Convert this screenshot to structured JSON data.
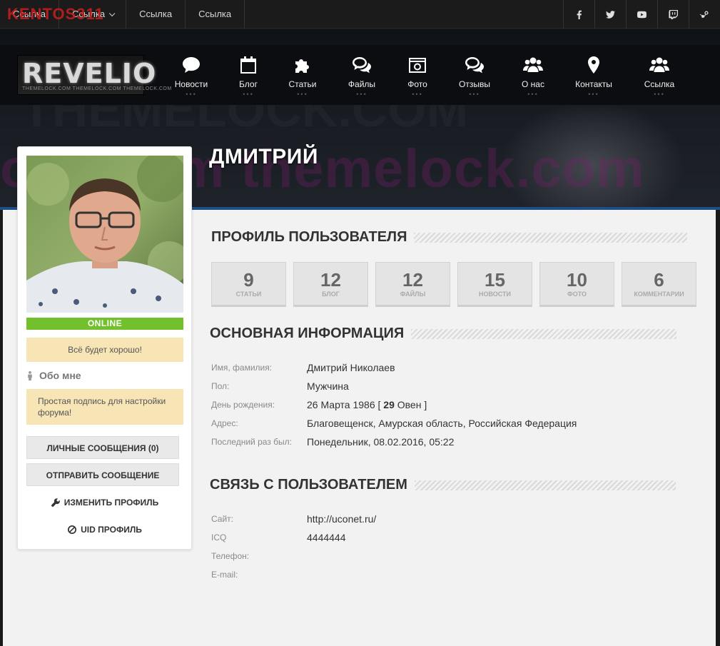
{
  "topbar": {
    "links": [
      {
        "label": "Ссылка",
        "has_caret": false
      },
      {
        "label": "Ссылка",
        "has_caret": true
      },
      {
        "label": "Ссылка",
        "has_caret": false
      },
      {
        "label": "Ссылка",
        "has_caret": false
      }
    ],
    "watermark": "KENTOS311",
    "socials": [
      "facebook-icon",
      "twitter-icon",
      "youtube-icon",
      "twitch-icon",
      "steam-icon"
    ]
  },
  "header": {
    "logo": "REVELIO",
    "logo_sub": "THEMELOCK.COM THEMELOCK.COM THEMELOCK.COM",
    "bg_text": "ock.com themelock.com",
    "bg_text2": "THEMELOCK.COM",
    "profile_name": "ДМИТРИЙ"
  },
  "nav": [
    {
      "label": "Новости",
      "icon": "comment-icon"
    },
    {
      "label": "Блог",
      "icon": "calendar-icon"
    },
    {
      "label": "Статьи",
      "icon": "puzzle-icon"
    },
    {
      "label": "Файлы",
      "icon": "comments-icon"
    },
    {
      "label": "Фото",
      "icon": "camera-icon"
    },
    {
      "label": "Отзывы",
      "icon": "comments-icon"
    },
    {
      "label": "О нас",
      "icon": "users-icon"
    },
    {
      "label": "Контакты",
      "icon": "map-marker-icon"
    },
    {
      "label": "Ссылка",
      "icon": "users-icon"
    }
  ],
  "sidebar": {
    "online": "ONLINE",
    "status": "Всё будет хорошо!",
    "about_title": "Обо мне",
    "signature": "Простая подпись для настройки форума!",
    "btn_messages": "Личные сообщения (0)",
    "btn_send": "Отправить сообщение",
    "link_edit": "Изменить профиль",
    "link_uid": "UID профиль"
  },
  "profile": {
    "title": "Профиль пользователя",
    "stats": [
      {
        "value": "9",
        "label": "Статьи"
      },
      {
        "value": "12",
        "label": "Блог"
      },
      {
        "value": "12",
        "label": "Файлы"
      },
      {
        "value": "15",
        "label": "Новости"
      },
      {
        "value": "10",
        "label": "Фото"
      },
      {
        "value": "6",
        "label": "Комментарии"
      }
    ]
  },
  "basic": {
    "title": "Основная информация",
    "rows": [
      {
        "label": "Имя, фамилия:",
        "value": "Дмитрий Николаев"
      },
      {
        "label": "Пол:",
        "value": "Мужчина"
      },
      {
        "label": "День рождения:",
        "value": "26 Марта 1986 [",
        "bold": "29",
        "value_after": "Овен ]"
      },
      {
        "label": "Адрес:",
        "value": "Благовещенск, Амурская область, Российская Федерация"
      },
      {
        "label": "Последний раз был:",
        "value": "Понедельник, 08.02.2016, 05:22"
      }
    ]
  },
  "contact": {
    "title": "Связь с пользователем",
    "rows": [
      {
        "label": "Сайт:",
        "value": "http://uconet.ru/"
      },
      {
        "label": "ICQ",
        "value": "4444444"
      },
      {
        "label": "Телефон:",
        "value": ""
      },
      {
        "label": "E-mail:",
        "value": ""
      }
    ]
  }
}
